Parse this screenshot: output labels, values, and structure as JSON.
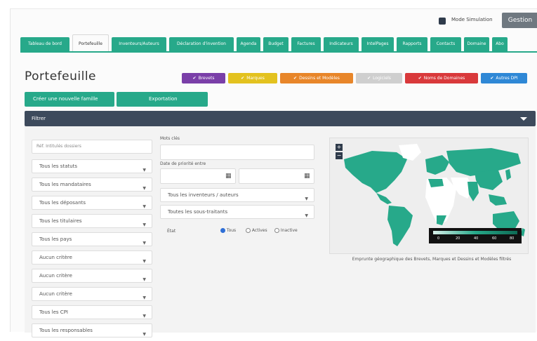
{
  "header": {
    "simulation_label": "Mode Simulation",
    "gestion_label": "Gestion"
  },
  "tabs": [
    {
      "label": "Tableau de bord",
      "active": false
    },
    {
      "label": "Portefeuille",
      "active": true
    },
    {
      "label": "Inventeurs/Auteurs",
      "active": false
    },
    {
      "label": "Déclaration d'invention",
      "active": false
    },
    {
      "label": "Agenda",
      "active": false
    },
    {
      "label": "Budget",
      "active": false
    },
    {
      "label": "Factures",
      "active": false
    },
    {
      "label": "Indicateurs",
      "active": false
    },
    {
      "label": "IntelPages",
      "active": false
    },
    {
      "label": "Rapports",
      "active": false
    },
    {
      "label": "Contacts",
      "active": false
    },
    {
      "label": "Domaine",
      "active": false
    },
    {
      "label": "Abo",
      "active": false
    }
  ],
  "page": {
    "title": "Portefeuille"
  },
  "chips": [
    {
      "label": "Brevets",
      "color": "#7a3fa8"
    },
    {
      "label": "Marques",
      "color": "#e3c21f"
    },
    {
      "label": "Dessins et Modèles",
      "color": "#e8862a"
    },
    {
      "label": "Logiciels",
      "color": "#cfcfcf"
    },
    {
      "label": "Noms de Domaines",
      "color": "#d9393b"
    },
    {
      "label": "Autres DPI",
      "color": "#2f88d6"
    }
  ],
  "actions": {
    "create_label": "Créer une nouvelle famille",
    "export_label": "Exportation"
  },
  "filters": {
    "bar_label": "Filtrer",
    "search_placeholder": "Réf. Intitulés dossiers",
    "selects": [
      "Tous les statuts",
      "Tous les mandataires",
      "Tous les déposants",
      "Tous les titulaires",
      "Tous les pays",
      "Aucun critère",
      "Aucun critère",
      "Aucun critère",
      "Tous les CPI",
      "Tous les responsables"
    ],
    "keyword_label": "Mots clés",
    "priority_date_label": "Date de priorité entre",
    "inventors_select": "Tous les inventeurs / auteurs",
    "subsidiaries_select": "Toutes les sous-traitants",
    "state_label": "État",
    "radios": [
      {
        "label": "Tous",
        "checked": true
      },
      {
        "label": "Actives",
        "checked": false
      },
      {
        "label": "Inactive",
        "checked": false
      }
    ]
  },
  "map": {
    "zoom_in": "+",
    "zoom_out": "−",
    "legend_ticks": [
      "0",
      "20",
      "40",
      "60",
      "80"
    ],
    "caption": "Emprunte géographique des Brevets, Marques et Dessins et Modèles filtrés",
    "land_color": "#27a98a",
    "empty_land_color": "#ffffff"
  }
}
